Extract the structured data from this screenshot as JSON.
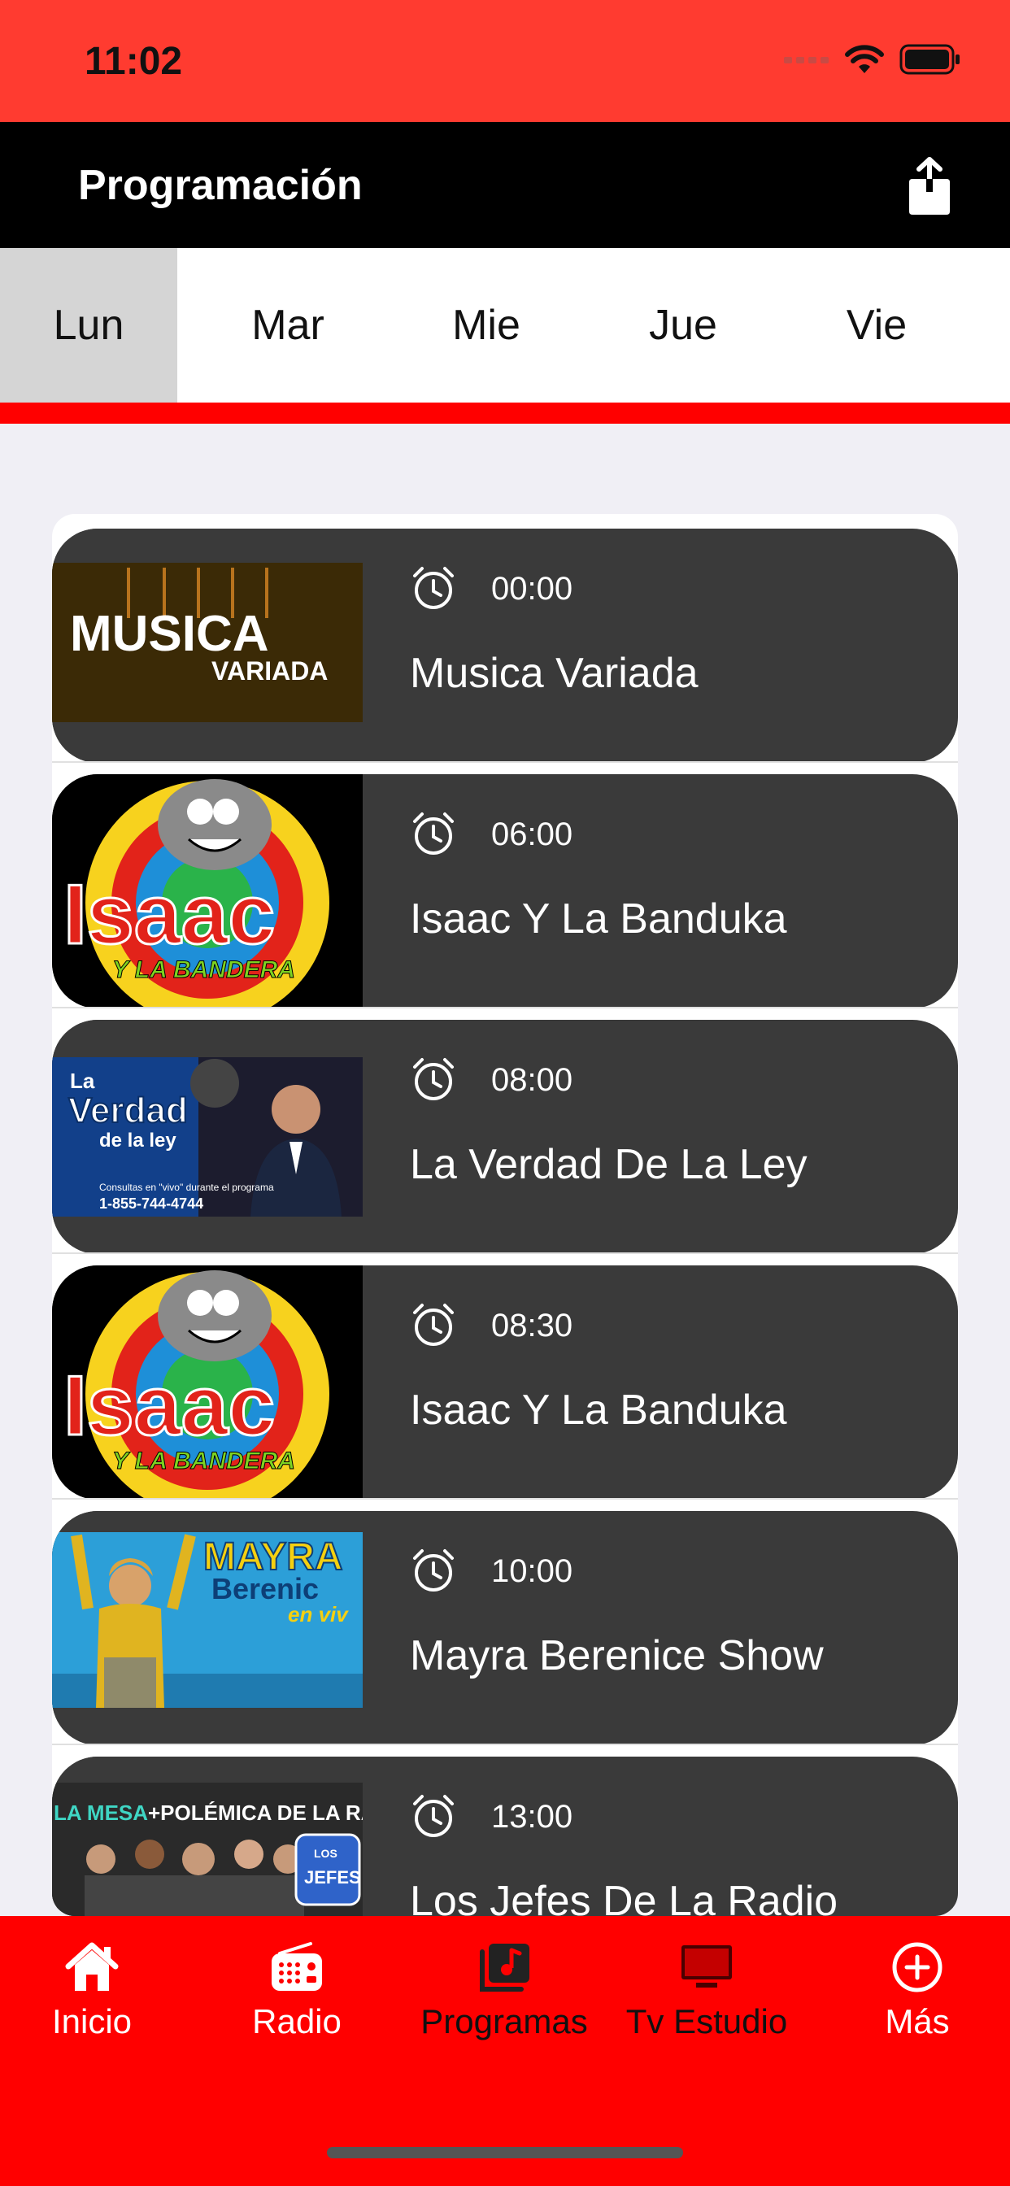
{
  "status": {
    "time": "11:02"
  },
  "nav": {
    "title": "Programación"
  },
  "days": [
    "Lun",
    "Mar",
    "Mie",
    "Jue",
    "Vie"
  ],
  "selected_day": "Lun",
  "programs": [
    {
      "time": "00:00",
      "title": "Musica Variada",
      "thumb_text": [
        "MUSICA",
        "VARIADA"
      ]
    },
    {
      "time": "06:00",
      "title": "Isaac Y La Banduka",
      "thumb_text": [
        "Isaac",
        "Y LA BANDERA"
      ]
    },
    {
      "time": "08:00",
      "title": "La Verdad De La Ley",
      "thumb_text": [
        "La",
        "Verdad",
        "de la ley",
        "Consultas en \"vivo\" durante el programa",
        "1-855-744-4744"
      ]
    },
    {
      "time": "08:30",
      "title": "Isaac Y La Banduka",
      "thumb_text": [
        "Isaac",
        "Y LA BANDERA"
      ]
    },
    {
      "time": "10:00",
      "title": "Mayra Berenice Show",
      "thumb_text": [
        "MAYRA",
        "Berenic",
        "en viv"
      ]
    },
    {
      "time": "13:00",
      "title": "Los Jefes De La Radio",
      "thumb_text": [
        "LA MESA",
        "+POLÉMICA DE LA RADIO",
        "LOS",
        "JEFES"
      ]
    }
  ],
  "tabbar": {
    "items": [
      {
        "label": "Inicio",
        "icon": "house-icon"
      },
      {
        "label": "Radio",
        "icon": "radio-icon"
      },
      {
        "label": "Programas",
        "icon": "music-library-icon"
      },
      {
        "label": "Tv  Estudio",
        "icon": "tv-icon"
      },
      {
        "label": "Más",
        "icon": "plus-circle-icon"
      }
    ]
  },
  "colors": {
    "accent": "#ff0000",
    "status_bar": "#ff3b30",
    "card": "#3a3a3a",
    "nav": "#000000"
  }
}
